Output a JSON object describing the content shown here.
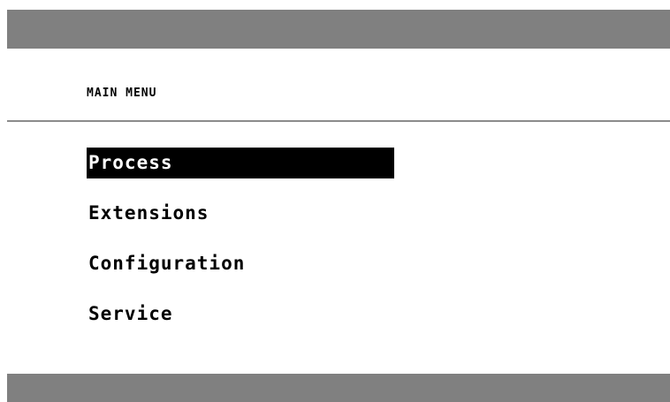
{
  "header": {
    "title": "MAIN MENU"
  },
  "menu": {
    "items": [
      {
        "label": "Process",
        "selected": true
      },
      {
        "label": "Extensions",
        "selected": false
      },
      {
        "label": "Configuration",
        "selected": false
      },
      {
        "label": "Service",
        "selected": false
      }
    ]
  },
  "colors": {
    "bar": "#808080",
    "divider": "#8c8c8c",
    "selection_background": "#000000",
    "selection_text": "#ffffff",
    "text": "#000000",
    "background": "#ffffff"
  }
}
